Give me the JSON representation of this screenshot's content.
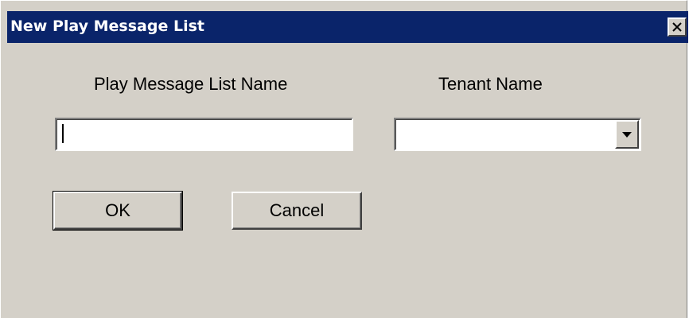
{
  "window": {
    "title": "New Play Message List",
    "close_icon": "close-icon"
  },
  "form": {
    "list_name_label": "Play Message List Name",
    "list_name_value": "",
    "tenant_label": "Tenant Name",
    "tenant_value": "",
    "dropdown_icon": "chevron-down-icon"
  },
  "buttons": {
    "ok_label": "OK",
    "cancel_label": "Cancel"
  },
  "colors": {
    "title_bar": "#0a246a",
    "dialog_face": "#d4d0c8"
  }
}
